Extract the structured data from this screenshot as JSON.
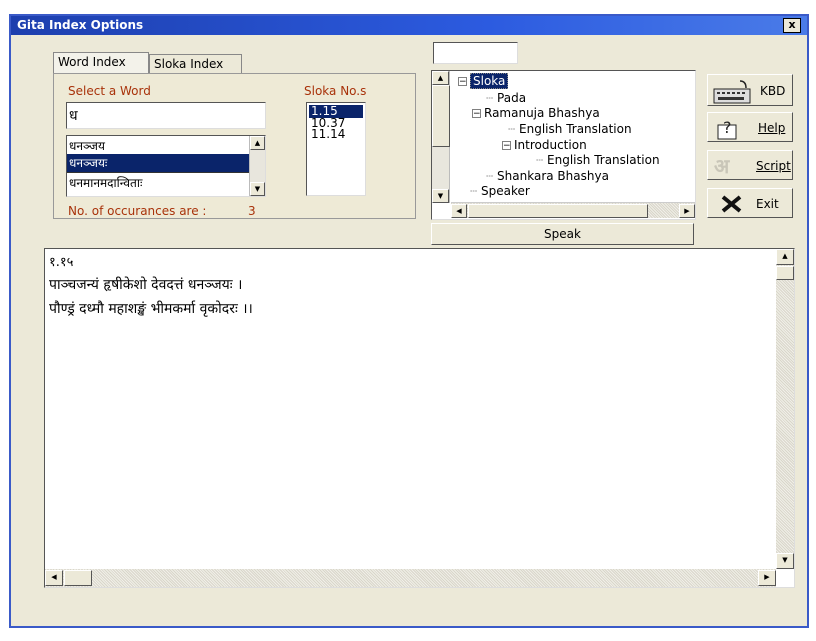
{
  "window": {
    "title": "Gita Index Options",
    "close_label": "x"
  },
  "tabs": [
    {
      "label": "Word Index",
      "active": true
    },
    {
      "label": "Sloka Index",
      "active": false
    }
  ],
  "word_index": {
    "select_word_label": "Select a Word",
    "word_input_value": "ध",
    "sloka_nos_label": "Sloka No.s",
    "words": [
      "धनञ्जय",
      "धनञ्जयः",
      "धनमानमदान्विताः"
    ],
    "selected_word_index": 1,
    "sloka_numbers": [
      "1.15",
      "10.37",
      "11.14"
    ],
    "selected_sloka_index": 0,
    "occurrences_label": "No. of occurances are :",
    "occurrences_value": "3"
  },
  "top_input_value": "",
  "tree": {
    "items": [
      {
        "label": "Sloka",
        "expander": "−",
        "selected": true
      },
      {
        "label": "Pada"
      },
      {
        "label": "Ramanuja Bhashya",
        "expander": "−"
      },
      {
        "label": "English Translation"
      },
      {
        "label": "Introduction",
        "expander": "−"
      },
      {
        "label": "English Translation"
      },
      {
        "label": "Shankara Bhashya"
      },
      {
        "label": "Speaker"
      }
    ]
  },
  "speak_label": "Speak",
  "side_buttons": {
    "kbd_label": "KBD",
    "help_label": "Help",
    "script_label": "Script",
    "exit_label": "Exit"
  },
  "content": {
    "lines": [
      "१.१५",
      "पाञ्चजन्यं हृषीकेशो देवदत्तं धनञ्जयः ।",
      "पौण्ड्रं दध्मौ महाशङ्खं भीमकर्मा वृकोदरः ।।"
    ]
  }
}
